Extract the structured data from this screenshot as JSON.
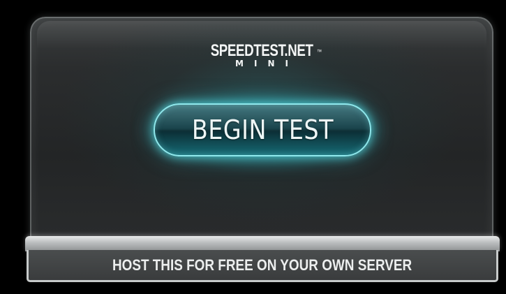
{
  "logo": {
    "title": "SPEEDTEST.NET",
    "trademark": "™",
    "subtitle": "MINI"
  },
  "main": {
    "begin_button_label": "BEGIN TEST"
  },
  "footer": {
    "host_label": "HOST THIS FOR FREE ON YOUR OWN SERVER"
  },
  "colors": {
    "background": "#000000",
    "panel": "#2b2d2e",
    "button_glow": "#5adce4",
    "text": "#eef6f6"
  }
}
